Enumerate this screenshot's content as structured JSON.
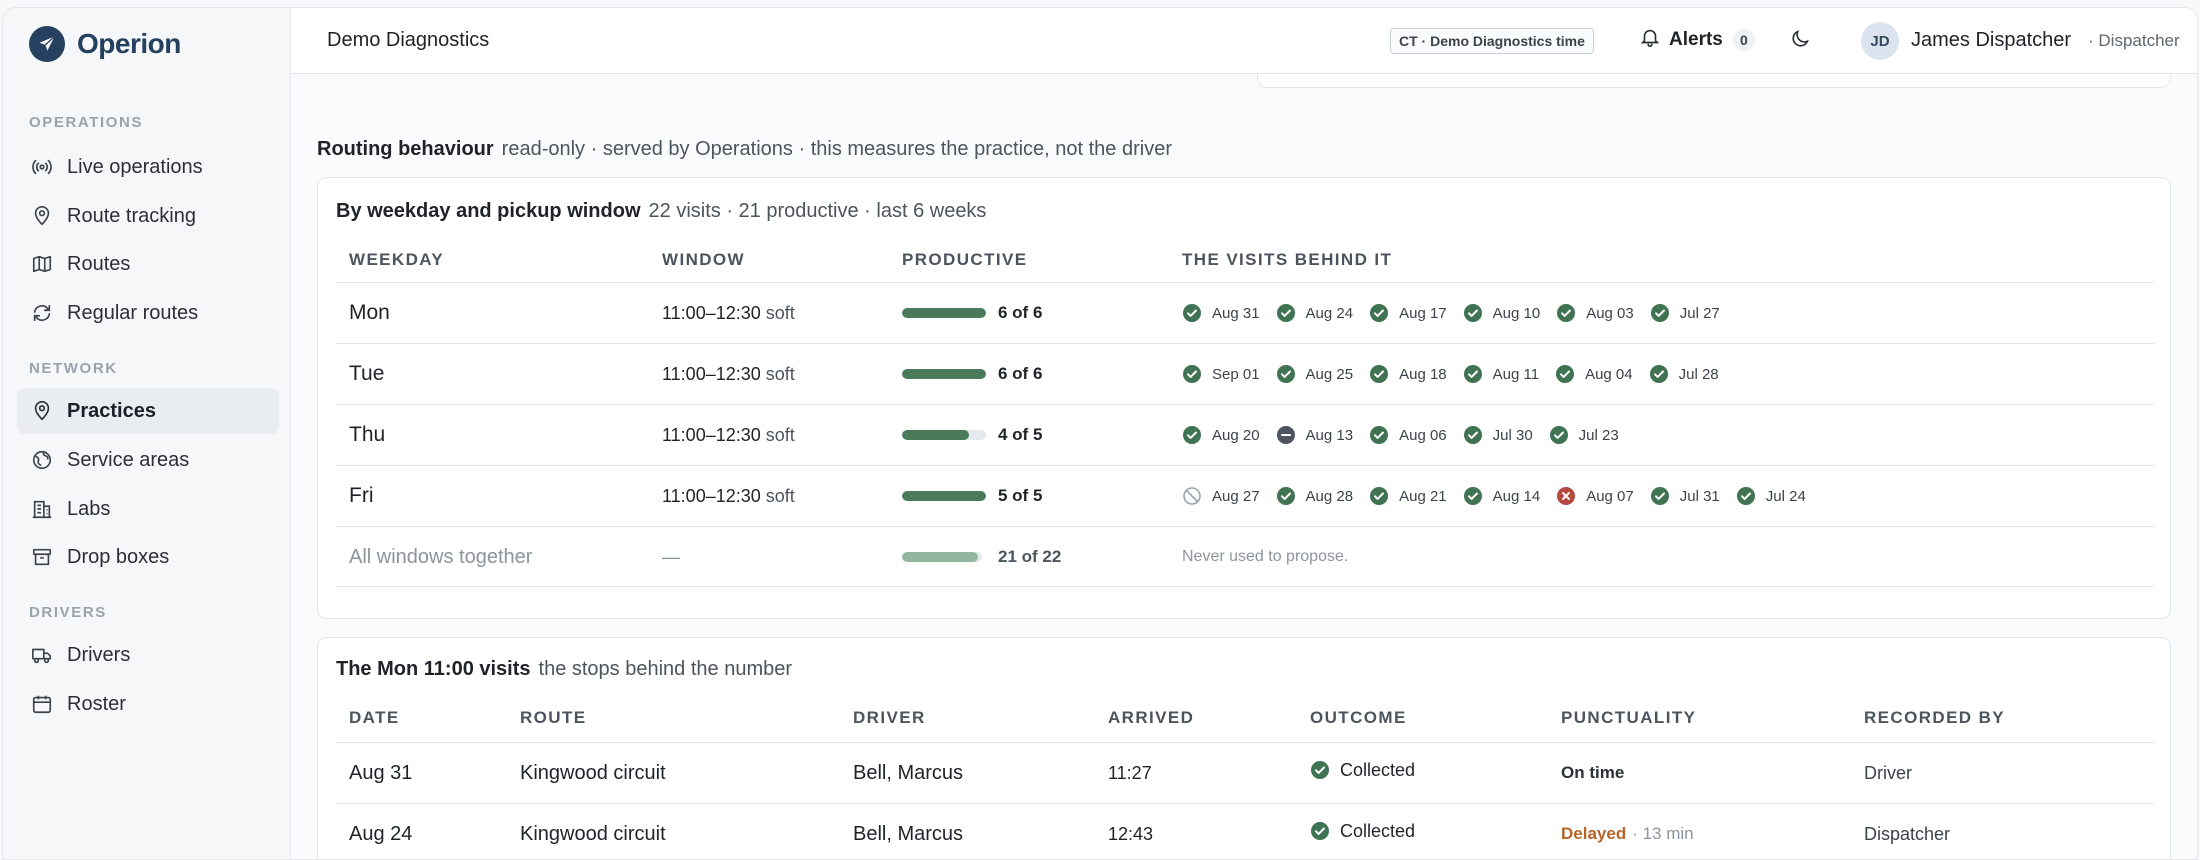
{
  "brand": {
    "name": "Operion"
  },
  "sidebar": {
    "sections": [
      {
        "label": "OPERATIONS",
        "items": [
          {
            "label": "Live operations",
            "icon": "broadcast-icon"
          },
          {
            "label": "Route tracking",
            "icon": "location-pin-icon"
          },
          {
            "label": "Routes",
            "icon": "map-icon"
          },
          {
            "label": "Regular routes",
            "icon": "repeat-icon"
          }
        ]
      },
      {
        "label": "NETWORK",
        "items": [
          {
            "label": "Practices",
            "icon": "location-pin-icon",
            "active": true
          },
          {
            "label": "Service areas",
            "icon": "globe-icon"
          },
          {
            "label": "Labs",
            "icon": "building-icon"
          },
          {
            "label": "Drop boxes",
            "icon": "archive-icon"
          }
        ]
      },
      {
        "label": "DRIVERS",
        "items": [
          {
            "label": "Drivers",
            "icon": "truck-icon"
          },
          {
            "label": "Roster",
            "icon": "calendar-icon"
          }
        ]
      }
    ]
  },
  "topbar": {
    "title": "Demo Diagnostics",
    "timezone_badge": "CT · Demo Diagnostics time",
    "alerts_label": "Alerts",
    "alerts_count": "0",
    "user_initials": "JD",
    "user_name": "James Dispatcher",
    "user_role": "· Dispatcher"
  },
  "routing": {
    "title": "Routing behaviour",
    "subtitle": "read-only · served by Operations · this measures the practice, not the driver"
  },
  "weekday_card": {
    "title": "By weekday and pickup window",
    "subtitle": "22 visits · 21 productive · last 6 weeks",
    "headers": {
      "weekday": "WEEKDAY",
      "window": "WINDOW",
      "productive": "PRODUCTIVE",
      "visits": "THE VISITS BEHIND IT"
    },
    "rows": [
      {
        "weekday": "Mon",
        "window": "11:00–12:30",
        "window_type": "soft",
        "productive": "6 of 6",
        "fraction": 1.0,
        "visits": [
          {
            "date": "Aug 31",
            "status": "ok"
          },
          {
            "date": "Aug 24",
            "status": "ok"
          },
          {
            "date": "Aug 17",
            "status": "ok"
          },
          {
            "date": "Aug 10",
            "status": "ok"
          },
          {
            "date": "Aug 03",
            "status": "ok"
          },
          {
            "date": "Jul 27",
            "status": "ok"
          }
        ]
      },
      {
        "weekday": "Tue",
        "window": "11:00–12:30",
        "window_type": "soft",
        "productive": "6 of 6",
        "fraction": 1.0,
        "visits": [
          {
            "date": "Sep 01",
            "status": "ok"
          },
          {
            "date": "Aug 25",
            "status": "ok"
          },
          {
            "date": "Aug 18",
            "status": "ok"
          },
          {
            "date": "Aug 11",
            "status": "ok"
          },
          {
            "date": "Aug 04",
            "status": "ok"
          },
          {
            "date": "Jul 28",
            "status": "ok"
          }
        ]
      },
      {
        "weekday": "Thu",
        "window": "11:00–12:30",
        "window_type": "soft",
        "productive": "4 of 5",
        "fraction": 0.8,
        "visits": [
          {
            "date": "Aug 20",
            "status": "ok"
          },
          {
            "date": "Aug 13",
            "status": "minus"
          },
          {
            "date": "Aug 06",
            "status": "ok"
          },
          {
            "date": "Jul 30",
            "status": "ok"
          },
          {
            "date": "Jul 23",
            "status": "ok"
          }
        ]
      },
      {
        "weekday": "Fri",
        "window": "11:00–12:30",
        "window_type": "soft",
        "productive": "5 of 5",
        "fraction": 1.0,
        "visits": [
          {
            "date": "Aug 27",
            "status": "skipped"
          },
          {
            "date": "Aug 28",
            "status": "ok"
          },
          {
            "date": "Aug 21",
            "status": "ok"
          },
          {
            "date": "Aug 14",
            "status": "ok"
          },
          {
            "date": "Aug 07",
            "status": "failed"
          },
          {
            "date": "Jul 31",
            "status": "ok"
          },
          {
            "date": "Jul 24",
            "status": "ok"
          }
        ]
      }
    ],
    "summary": {
      "label": "All windows together",
      "window": "—",
      "productive": "21 of 22",
      "fraction": 0.955,
      "note": "Never used to propose."
    }
  },
  "visits_card": {
    "title": "The Mon 11:00 visits",
    "subtitle": "the stops behind the number",
    "headers": {
      "date": "DATE",
      "route": "ROUTE",
      "driver": "DRIVER",
      "arrived": "ARRIVED",
      "outcome": "OUTCOME",
      "punctuality": "PUNCTUALITY",
      "recorded_by": "RECORDED BY"
    },
    "rows": [
      {
        "date": "Aug 31",
        "route": "Kingwood circuit",
        "driver": "Bell, Marcus",
        "arrived": "11:27",
        "outcome": "Collected",
        "punctuality": "On time",
        "delay": "",
        "recorded_by": "Driver"
      },
      {
        "date": "Aug 24",
        "route": "Kingwood circuit",
        "driver": "Bell, Marcus",
        "arrived": "12:43",
        "outcome": "Collected",
        "punctuality": "Delayed",
        "delay": "· 13 min",
        "recorded_by": "Dispatcher"
      }
    ]
  },
  "colors": {
    "ok": "#3f7351",
    "failed": "#b4473e",
    "minus": "#4e5560",
    "delayed": "#b5652a",
    "bar": "#4a7a5a",
    "bar_light": "#93b69e"
  }
}
